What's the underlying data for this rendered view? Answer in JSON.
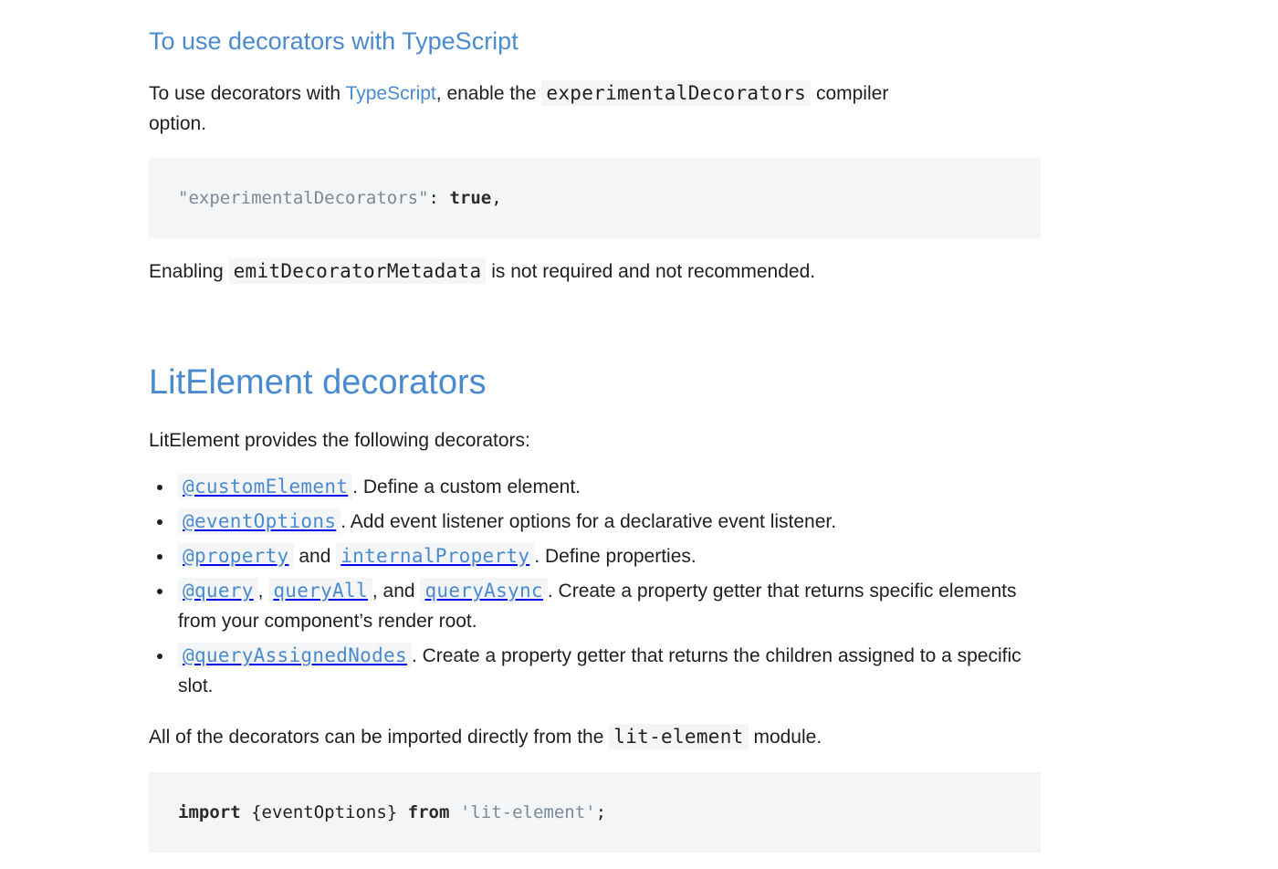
{
  "section_ts": {
    "heading": "To use decorators with TypeScript",
    "para_pre": "To use decorators with ",
    "para_link": "TypeScript",
    "para_mid": ", enable the ",
    "para_code": "experimentalDecorators",
    "para_post": " compiler option.",
    "code_block": {
      "string": "\"experimentalDecorators\"",
      "colon": ": ",
      "keyword": "true",
      "comma": ","
    },
    "note_pre": "Enabling ",
    "note_code": "emitDecoratorMetadata",
    "note_post": " is not required and not recommended."
  },
  "section_lit": {
    "heading": "LitElement decorators",
    "intro": "LitElement provides the following decorators:",
    "items": [
      {
        "codes": [
          "@customElement"
        ],
        "text": ". Define a custom element."
      },
      {
        "codes": [
          "@eventOptions"
        ],
        "text": ". Add event listener options for a declarative event listener."
      },
      {
        "codes": [
          "@property",
          "internalProperty"
        ],
        "joiners": [
          " and "
        ],
        "text": ". Define properties."
      },
      {
        "codes": [
          "@query",
          "queryAll",
          "queryAsync"
        ],
        "joiners": [
          ", ",
          ", and "
        ],
        "text": ". Create a property getter that returns specific elements from your component’s render root."
      },
      {
        "codes": [
          "@queryAssignedNodes"
        ],
        "text": ". Create a property getter that returns the children assigned to a specific slot."
      }
    ],
    "import_pre": "All of the decorators can be imported directly from the ",
    "import_code": "lit-element",
    "import_post": " module.",
    "code_block": {
      "kw_import": "import",
      "braces": " {eventOptions} ",
      "kw_from": "from",
      "space": " ",
      "string": "'lit-element'",
      "semi": ";"
    }
  }
}
